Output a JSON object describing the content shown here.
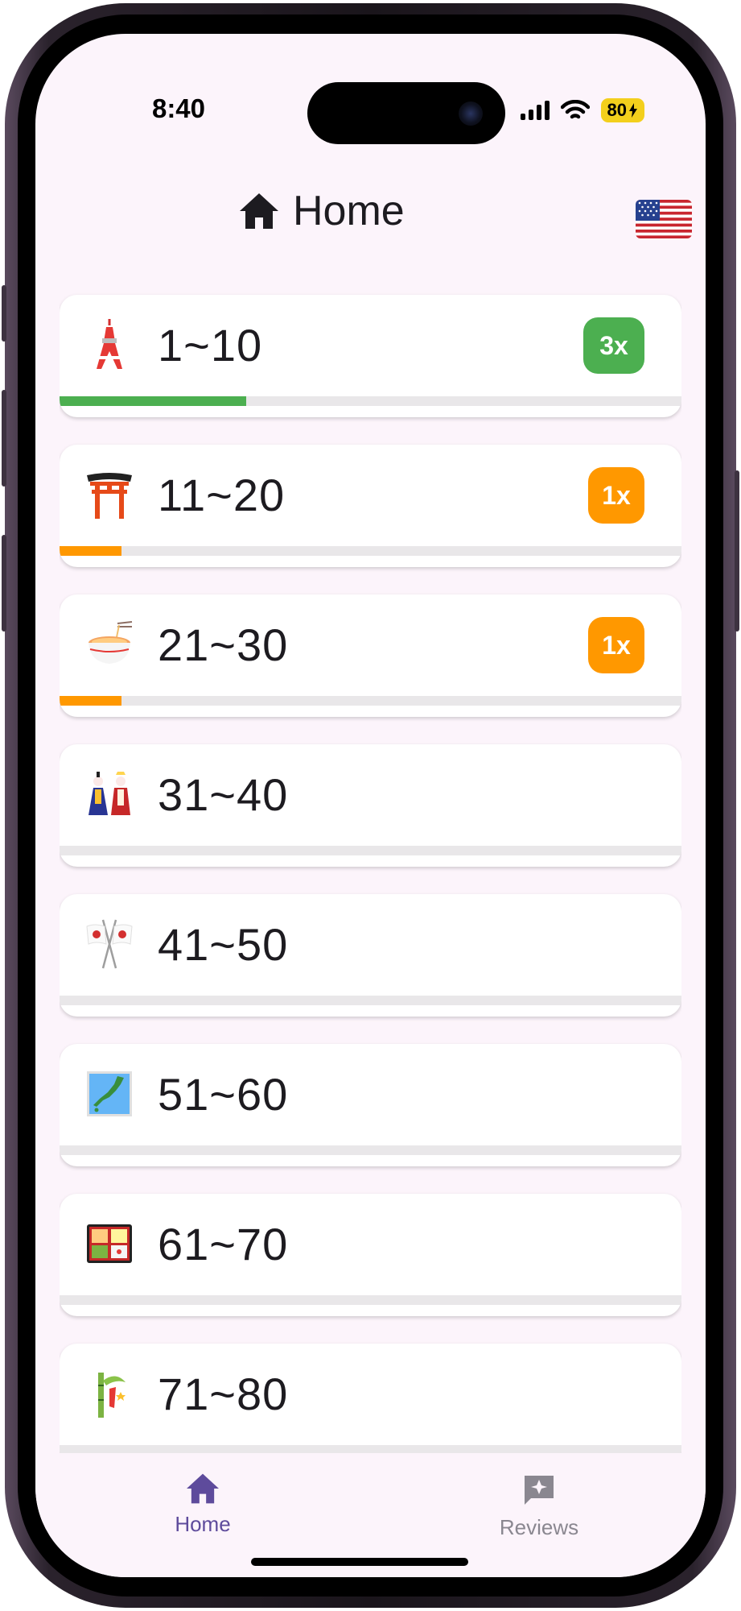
{
  "status": {
    "time": "8:40",
    "battery": "80"
  },
  "header": {
    "title": "Home",
    "title_icon": "home-icon",
    "language_flag": "us-flag-icon"
  },
  "colors": {
    "green": "#4caf50",
    "orange": "#ff9800",
    "accent": "#5e4b9c",
    "inactive": "#8a8790"
  },
  "items": [
    {
      "label": "1~10",
      "emoji": "tokyo-tower-icon",
      "badge": "3x",
      "badge_color": "green",
      "progress": 0.3
    },
    {
      "label": "11~20",
      "emoji": "torii-gate-icon",
      "badge": "1x",
      "badge_color": "orange",
      "progress": 0.1
    },
    {
      "label": "21~30",
      "emoji": "ramen-bowl-icon",
      "badge": "1x",
      "badge_color": "orange",
      "progress": 0.1
    },
    {
      "label": "31~40",
      "emoji": "hina-dolls-icon",
      "badge": "",
      "badge_color": "",
      "progress": 0
    },
    {
      "label": "41~50",
      "emoji": "crossed-flags-icon",
      "badge": "",
      "badge_color": "",
      "progress": 0
    },
    {
      "label": "51~60",
      "emoji": "japan-map-icon",
      "badge": "",
      "badge_color": "",
      "progress": 0
    },
    {
      "label": "61~70",
      "emoji": "bento-box-icon",
      "badge": "",
      "badge_color": "",
      "progress": 0
    },
    {
      "label": "71~80",
      "emoji": "tanabata-tree-icon",
      "badge": "",
      "badge_color": "",
      "progress": 0
    }
  ],
  "nav": {
    "home": {
      "label": "Home",
      "icon": "home-icon",
      "active": true
    },
    "reviews": {
      "label": "Reviews",
      "icon": "reviews-icon",
      "active": false
    }
  }
}
